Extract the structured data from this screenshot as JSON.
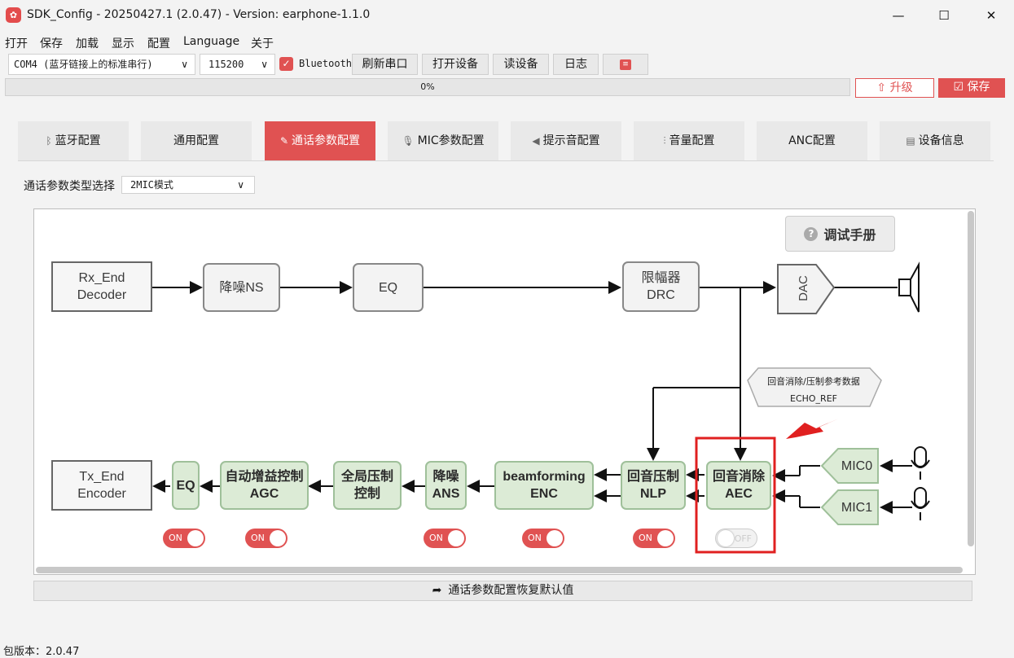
{
  "window": {
    "title": "SDK_Config -  20250427.1  (2.0.47) - Version: earphone-1.1.0",
    "icon": "app-logo-icon"
  },
  "menu": [
    "打开",
    "保存",
    "加载",
    "显示",
    "配置",
    "Language",
    "关于"
  ],
  "toolbar": {
    "port": "COM4 (蓝牙链接上的标准串行)",
    "baud": "115200",
    "bluetooth_label": "Bluetooth",
    "bluetooth_checked": true,
    "refresh": "刷新串口",
    "open": "打开设备",
    "read": "读设备",
    "log": "日志"
  },
  "progress": {
    "text": "0%",
    "value": 0
  },
  "actions": {
    "upgrade": "升级",
    "save": "保存"
  },
  "tabs": [
    {
      "label": "蓝牙配置",
      "icon": "bluetooth-icon"
    },
    {
      "label": "通用配置",
      "icon": ""
    },
    {
      "label": "通话参数配置",
      "icon": "edit-icon",
      "active": true
    },
    {
      "label": "MIC参数配置",
      "icon": "microphone-icon"
    },
    {
      "label": "提示音配置",
      "icon": "speaker-icon"
    },
    {
      "label": "音量配置",
      "icon": "waveform-icon"
    },
    {
      "label": "ANC配置",
      "icon": ""
    },
    {
      "label": "设备信息",
      "icon": "document-icon"
    }
  ],
  "type_select": {
    "label": "通话参数类型选择",
    "value": "2MIC模式"
  },
  "manual_button": "调试手册",
  "blocks": {
    "rx_end": "Rx_End\nDecoder",
    "ns": "降噪NS",
    "eq1": "EQ",
    "drc": "限幅器\nDRC",
    "dac": "DAC",
    "echo_ref_title": "回音消除/压制参考数据",
    "echo_ref_sub": "ECHO_REF",
    "tx_end": "Tx_End\nEncoder",
    "eq2": "EQ",
    "agc": "自动增益控制\nAGC",
    "global": "全局压制\n控制",
    "ans": "降噪\nANS",
    "enc": "beamforming\nENC",
    "nlp": "回音压制\nNLP",
    "aec": "回音消除\nAEC",
    "mic0": "MIC0",
    "mic1": "MIC1"
  },
  "toggles": {
    "eq": "ON",
    "agc": "ON",
    "ans": "ON",
    "enc": "ON",
    "nlp": "ON",
    "aec": "OFF"
  },
  "highlight_color": "#e02020",
  "restore_button": "通话参数配置恢复默认值",
  "footer": {
    "version": "包版本：2.0.47"
  }
}
